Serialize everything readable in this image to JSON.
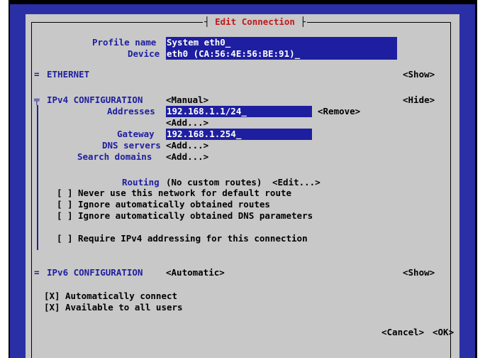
{
  "dialog": {
    "title": "Edit Connection",
    "profile_name_label": "Profile name",
    "profile_name_value": "System eth0_",
    "device_label": "Device",
    "device_value": "eth0 (CA:56:4E:56:BE:91)_"
  },
  "ethernet": {
    "marker": "=",
    "label": "ETHERNET",
    "toggle": "<Show>"
  },
  "ipv4": {
    "marker": "╤",
    "label": "IPv4 CONFIGURATION",
    "method": "<Manual>",
    "toggle": "<Hide>",
    "addresses_label": "Addresses",
    "address_value": "192.168.1.1/24_",
    "remove_button": "<Remove>",
    "add_address_button": "<Add...>",
    "gateway_label": "Gateway",
    "gateway_value": "192.168.1.254_",
    "dns_label": "DNS servers",
    "dns_add_button": "<Add...>",
    "search_label": "Search domains",
    "search_add_button": "<Add...>",
    "routing_label": "Routing",
    "routing_value": "(No custom routes)",
    "routing_edit_button": "<Edit...>",
    "never_default_checkbox": "[ ]",
    "never_default_label": "Never use this network for default route",
    "ignore_routes_checkbox": "[ ]",
    "ignore_routes_label": "Ignore automatically obtained routes",
    "ignore_dns_checkbox": "[ ]",
    "ignore_dns_label": "Ignore automatically obtained DNS parameters",
    "require_ipv4_checkbox": "[ ]",
    "require_ipv4_label": "Require IPv4 addressing for this connection"
  },
  "ipv6": {
    "marker": "=",
    "label": "IPv6 CONFIGURATION",
    "method": "<Automatic>",
    "toggle": "<Show>"
  },
  "options": {
    "auto_connect_checkbox": "[X]",
    "auto_connect_label": "Automatically connect",
    "all_users_checkbox": "[X]",
    "all_users_label": "Available to all users"
  },
  "buttons": {
    "cancel": "<Cancel>",
    "ok": "<OK>"
  },
  "colors": {
    "background_blue": "#2a2fa6",
    "dialog_gray": "#c8c8c8",
    "field_blue": "#1e1ea0",
    "title_red": "#c11818"
  }
}
